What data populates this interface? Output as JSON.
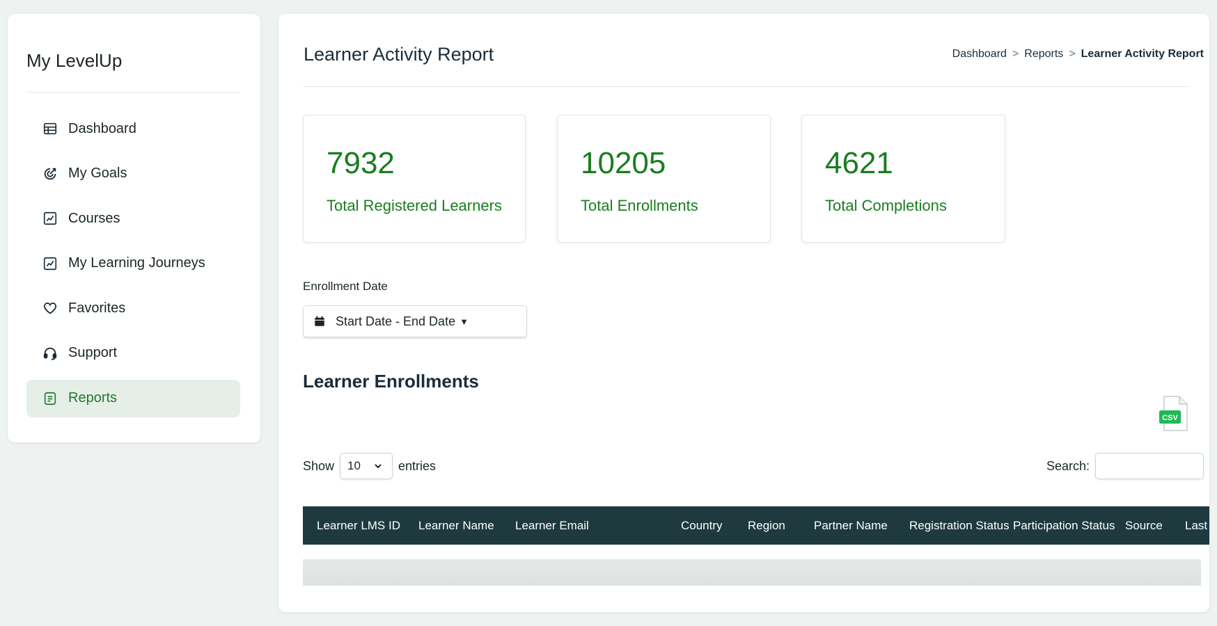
{
  "sidebar": {
    "brand": "My LevelUp",
    "items": [
      {
        "label": "Dashboard",
        "icon": "table-grid-icon"
      },
      {
        "label": "My Goals",
        "icon": "target-icon"
      },
      {
        "label": "Courses",
        "icon": "chart-box-icon"
      },
      {
        "label": "My Learning Journeys",
        "icon": "chart-box-icon"
      },
      {
        "label": "Favorites",
        "icon": "heart-icon"
      },
      {
        "label": "Support",
        "icon": "headset-icon"
      },
      {
        "label": "Reports",
        "icon": "report-icon",
        "active": true
      }
    ]
  },
  "header": {
    "title": "Learner Activity Report",
    "breadcrumb": [
      "Dashboard",
      "Reports",
      "Learner Activity Report"
    ],
    "breadcrumb_sep": ">"
  },
  "stats": [
    {
      "value": "7932",
      "label": "Total Registered Learners"
    },
    {
      "value": "10205",
      "label": "Total Enrollments"
    },
    {
      "value": "4621",
      "label": "Total Completions"
    }
  ],
  "filter": {
    "label": "Enrollment Date",
    "value": "Start Date - End Date"
  },
  "enrollments": {
    "title": "Learner Enrollments",
    "csv_label": "CSV",
    "show_label": "Show",
    "entries_value": "10",
    "entries_label": "entries",
    "search_label": "Search:",
    "search_value": "",
    "columns": [
      "Learner LMS ID",
      "Learner Name",
      "Learner Email",
      "Country",
      "Region",
      "Partner Name",
      "Registration Status",
      "Participation Status",
      "Source",
      "Last"
    ]
  },
  "colors": {
    "accent_green": "#1a7d1f",
    "table_header": "#1e3a3e",
    "active_nav_bg": "#e6efe7",
    "csv_green": "#1db954"
  }
}
